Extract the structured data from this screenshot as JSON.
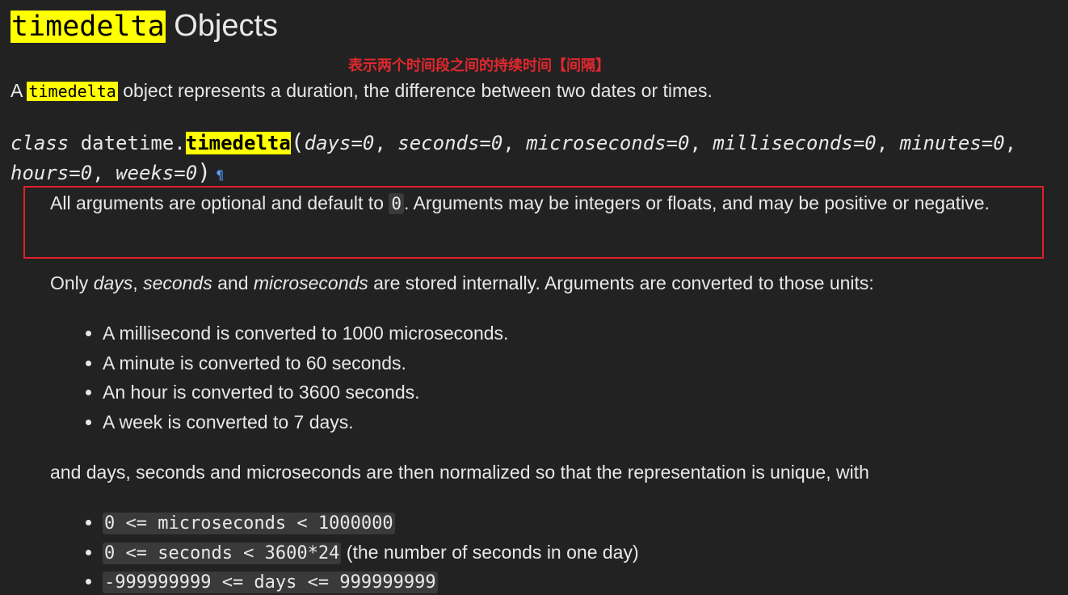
{
  "title": {
    "code": "timedelta",
    "rest": " Objects"
  },
  "annotation": "表示两个时间段之间的持续时间【间隔】",
  "intro": {
    "prefix": "A ",
    "code": "timedelta",
    "suffix": " object represents a duration, the difference between two dates or times."
  },
  "signature": {
    "keyword": "class",
    "module": "datetime.",
    "name": "timedelta",
    "open_paren": "(",
    "params": [
      "days=0",
      "seconds=0",
      "microseconds=0",
      "milliseconds=0",
      "minutes=0",
      "hours=0",
      "weeks=0"
    ],
    "separator": ", ",
    "close_paren": ")",
    "pilcrow": "¶"
  },
  "boxed_para": {
    "before": "All arguments are optional and default to ",
    "code": "0",
    "after": ". Arguments may be integers or floats, and may be positive or negative."
  },
  "only_para": {
    "t1": "Only ",
    "e1": "days",
    "t2": ", ",
    "e2": "seconds",
    "t3": " and ",
    "e3": "microseconds",
    "t4": " are stored internally. Arguments are converted to those units:"
  },
  "units_list": [
    "A millisecond is converted to 1000 microseconds.",
    "A minute is converted to 60 seconds.",
    "An hour is converted to 3600 seconds.",
    "A week is converted to 7 days."
  ],
  "normalize_para": "and days, seconds and microseconds are then normalized so that the representation is unique, with",
  "range_list": [
    {
      "code": "0 <= microseconds < 1000000",
      "text": ""
    },
    {
      "code": "0 <= seconds < 3600*24",
      "text": " (the number of seconds in one day)"
    },
    {
      "code": "-999999999 <= days <= 999999999",
      "text": ""
    }
  ]
}
